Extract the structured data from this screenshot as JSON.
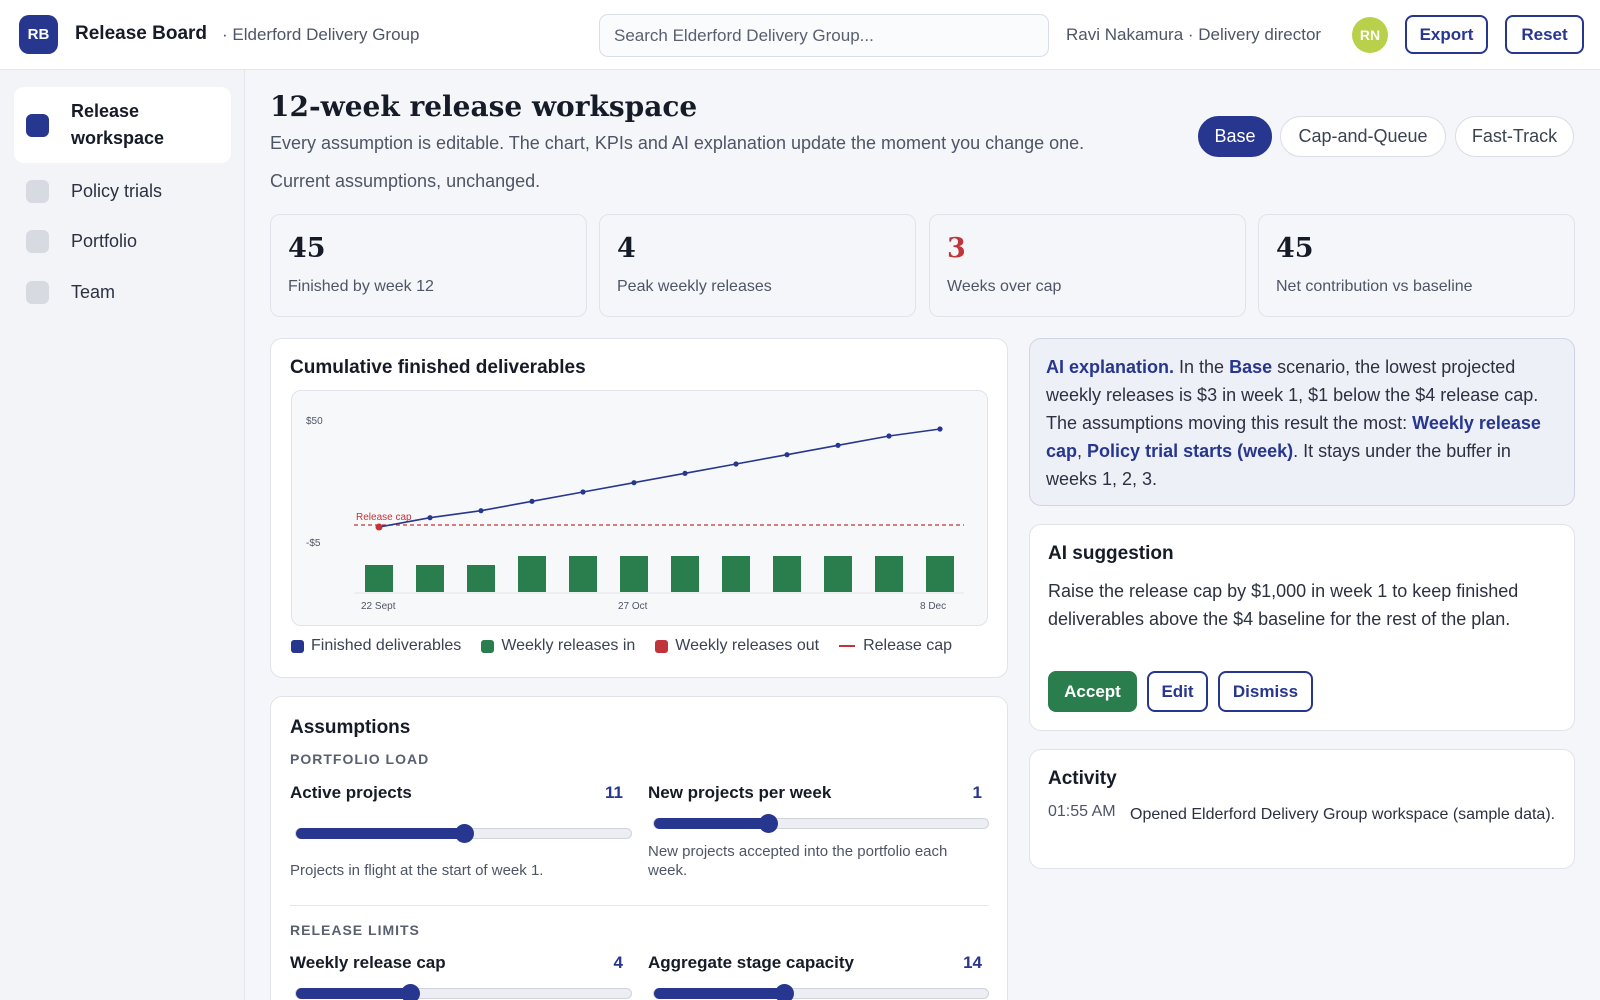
{
  "header": {
    "logo": "RB",
    "app_title": "Release Board",
    "org": "· Elderford Delivery Group",
    "search_placeholder": "Search Elderford Delivery Group...",
    "user": "Ravi Nakamura · Delivery director",
    "avatar": "RN",
    "export_label": "Export",
    "reset_label": "Reset"
  },
  "sidebar": {
    "items": [
      {
        "label": "Release workspace",
        "active": true
      },
      {
        "label": "Policy trials"
      },
      {
        "label": "Portfolio"
      },
      {
        "label": "Team"
      }
    ]
  },
  "page": {
    "title": "12-week release workspace",
    "subtitle": "Every assumption is editable. The chart, KPIs and AI explanation update the moment you change one.",
    "status": "Current assumptions, unchanged."
  },
  "scenarios": [
    "Base",
    "Cap-and-Queue",
    "Fast-Track"
  ],
  "active_scenario": "Base",
  "kpis": [
    {
      "value": "45",
      "label": "Finished by week 12"
    },
    {
      "value": "4",
      "label": "Peak weekly releases"
    },
    {
      "value": "3",
      "label": "Weeks over cap"
    },
    {
      "value": "45",
      "label": "Net contribution vs baseline"
    }
  ],
  "chart_panel": {
    "title": "Cumulative finished deliverables",
    "legend": [
      "Finished deliverables",
      "Weekly releases in",
      "Weekly releases out",
      "Release cap"
    ]
  },
  "chart_data": {
    "type": "bar",
    "title": "Cumulative finished deliverables",
    "x_tick_labels": [
      "22 Sept",
      "27 Oct",
      "8 Dec"
    ],
    "y_tick_labels": [
      "$50",
      "-$5"
    ],
    "weeks": [
      1,
      2,
      3,
      4,
      5,
      6,
      7,
      8,
      9,
      10,
      11,
      12
    ],
    "series": [
      {
        "name": "Finished deliverables",
        "type": "line",
        "values": [
          3,
          7,
          10,
          14,
          18,
          22,
          26,
          30,
          34,
          38,
          42,
          45
        ]
      },
      {
        "name": "Weekly releases in",
        "type": "bar",
        "values": [
          3,
          3,
          3,
          4,
          4,
          4,
          4,
          4,
          4,
          4,
          4,
          4
        ]
      },
      {
        "name": "Weekly releases out",
        "type": "bar",
        "values": [
          0,
          0,
          0,
          0,
          0,
          0,
          0,
          0,
          0,
          0,
          0,
          0
        ]
      }
    ],
    "release_cap": {
      "label": "Release cap",
      "value": 4
    },
    "colors": {
      "line": "#27368f",
      "bar_in": "#2a7d4c",
      "bar_out": "#c0343a",
      "cap": "#c0343a"
    }
  },
  "assumptions": {
    "title": "Assumptions",
    "sections": [
      {
        "name": "PORTFOLIO LOAD",
        "sliders": [
          {
            "label": "Active projects",
            "value": "11",
            "fraction": 0.5,
            "help": "Projects in flight at the start of week 1."
          },
          {
            "label": "New projects per week",
            "value": "1",
            "fraction": 0.34,
            "help": "New projects accepted into the portfolio each week."
          }
        ]
      },
      {
        "name": "RELEASE LIMITS",
        "sliders": [
          {
            "label": "Weekly release cap",
            "value": "4",
            "fraction": 0.34
          },
          {
            "label": "Aggregate stage capacity",
            "value": "14",
            "fraction": 0.39
          }
        ]
      }
    ]
  },
  "ai_explanation": {
    "lead": "AI explanation.",
    "t1": " In the ",
    "scenario": "Base",
    "t2": " scenario, the lowest projected weekly releases is $3 in week 1, $1 below the $4 release cap. The assumptions moving this result the most: ",
    "k1": "Weekly release cap",
    "t3": ", ",
    "k2": "Policy trial starts (week)",
    "t4": ". It stays under the buffer in weeks 1, 2, 3."
  },
  "ai_suggestion": {
    "title": "AI suggestion",
    "text": "Raise the release cap by $1,000 in week 1 to keep finished deliverables above the $4 baseline for the rest of the plan.",
    "accept": "Accept",
    "edit": "Edit",
    "dismiss": "Dismiss"
  },
  "activity": {
    "title": "Activity",
    "entries": [
      {
        "time": "01:55 AM",
        "text": "Opened Elderford Delivery Group workspace (sample data)."
      }
    ]
  }
}
